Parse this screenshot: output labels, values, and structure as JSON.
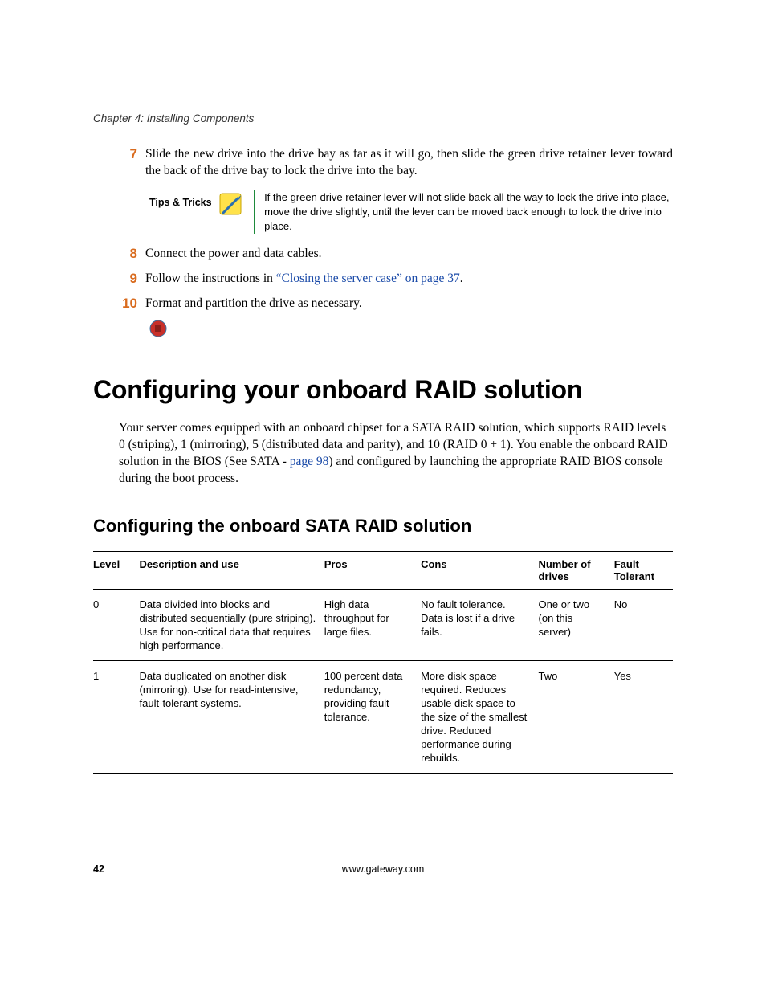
{
  "chapter_header": "Chapter 4: Installing Components",
  "steps": {
    "s7": {
      "num": "7",
      "text_a": "Slide the new drive into the drive bay as far as it will go, then slide the green drive retainer lever toward the back of the drive bay to lock the drive into the bay."
    },
    "s8": {
      "num": "8",
      "text_a": "Connect the power and data cables."
    },
    "s9": {
      "num": "9",
      "text_a": "Follow the instructions in ",
      "link": "“Closing the server case” on page 37",
      "text_b": "."
    },
    "s10": {
      "num": "10",
      "text_a": "Format and partition the drive as necessary."
    }
  },
  "tips": {
    "label": "Tips & Tricks",
    "text": "If the green drive retainer lever will not slide back all the way to lock the drive into place, move the drive slightly, until the lever can be moved back enough to lock the drive into place."
  },
  "section": {
    "title": "Configuring your onboard RAID solution",
    "para_a": "Your server comes equipped with an onboard chipset for a SATA RAID solution, which supports RAID levels 0 (striping), 1 (mirroring), 5 (distributed data and parity), and 10 (RAID 0 + 1). You enable the onboard RAID solution in the BIOS (See SATA - ",
    "para_link": "page 98",
    "para_b": ") and configured by launching the appropriate RAID BIOS console during the boot process."
  },
  "subsection": {
    "title": "Configuring the onboard SATA RAID solution"
  },
  "table": {
    "headers": {
      "level": "Level",
      "desc": "Description and use",
      "pros": "Pros",
      "cons": "Cons",
      "drives": "Number of drives",
      "fault": "Fault Tolerant"
    },
    "rows": [
      {
        "level": "0",
        "desc": "Data divided into blocks and distributed sequentially (pure striping). Use for non-critical data that requires high performance.",
        "pros": "High data throughput for large files.",
        "cons": "No fault tolerance. Data is lost if a drive fails.",
        "drives": "One or two (on this server)",
        "fault": "No"
      },
      {
        "level": "1",
        "desc": "Data duplicated on another disk (mirroring). Use for read-intensive, fault-tolerant systems.",
        "pros": "100 percent data redundancy, providing fault tolerance.",
        "cons": "More disk space required. Reduces usable disk space to the size of the smallest drive. Reduced performance during rebuilds.",
        "drives": "Two",
        "fault": "Yes"
      }
    ]
  },
  "footer": {
    "page": "42",
    "url": "www.gateway.com"
  }
}
